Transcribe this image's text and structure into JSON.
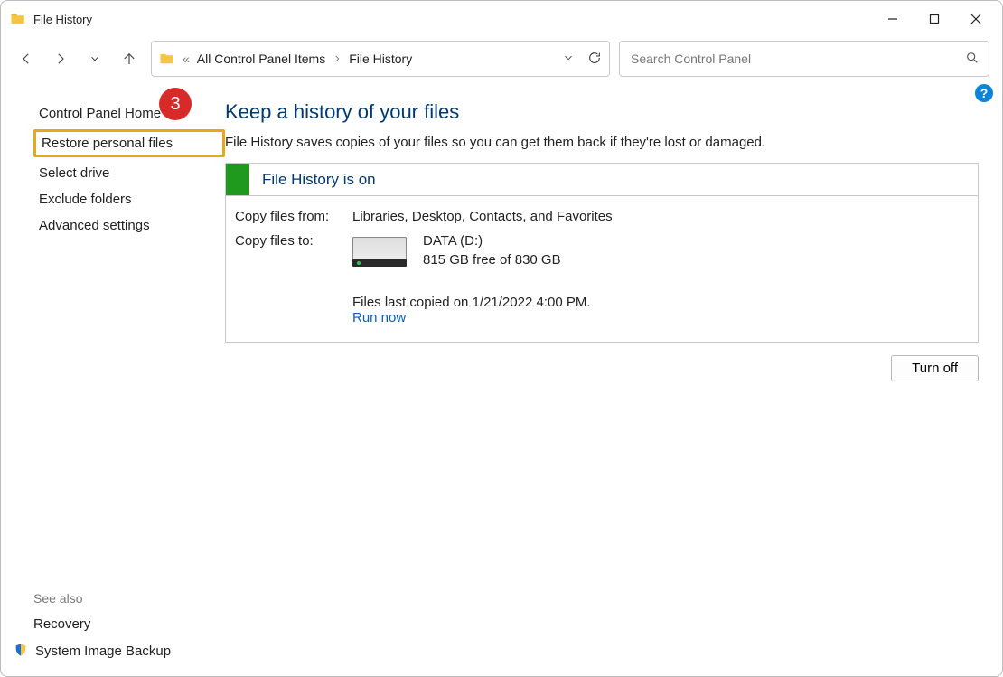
{
  "window": {
    "title": "File History"
  },
  "breadcrumb": {
    "overflow_glyph": "«",
    "item1": "All Control Panel Items",
    "item2": "File History"
  },
  "search": {
    "placeholder": "Search Control Panel"
  },
  "sidebar": {
    "home": "Control Panel Home",
    "restore": "Restore personal files",
    "select_drive": "Select drive",
    "exclude": "Exclude folders",
    "advanced": "Advanced settings",
    "badge": "3",
    "see_also_label": "See also",
    "recovery": "Recovery",
    "system_image": "System Image Backup"
  },
  "main": {
    "title": "Keep a history of your files",
    "subtitle": "File History saves copies of your files so you can get them back if they're lost or damaged.",
    "status_title": "File History is on",
    "copy_from_label": "Copy files from:",
    "copy_from_value": "Libraries, Desktop, Contacts, and Favorites",
    "copy_to_label": "Copy files to:",
    "dest_name": "DATA (D:)",
    "dest_free": "815 GB free of 830 GB",
    "last_copied": "Files last copied on 1/21/2022 4:00 PM.",
    "run_now": "Run now",
    "turn_off": "Turn off",
    "help_glyph": "?"
  }
}
